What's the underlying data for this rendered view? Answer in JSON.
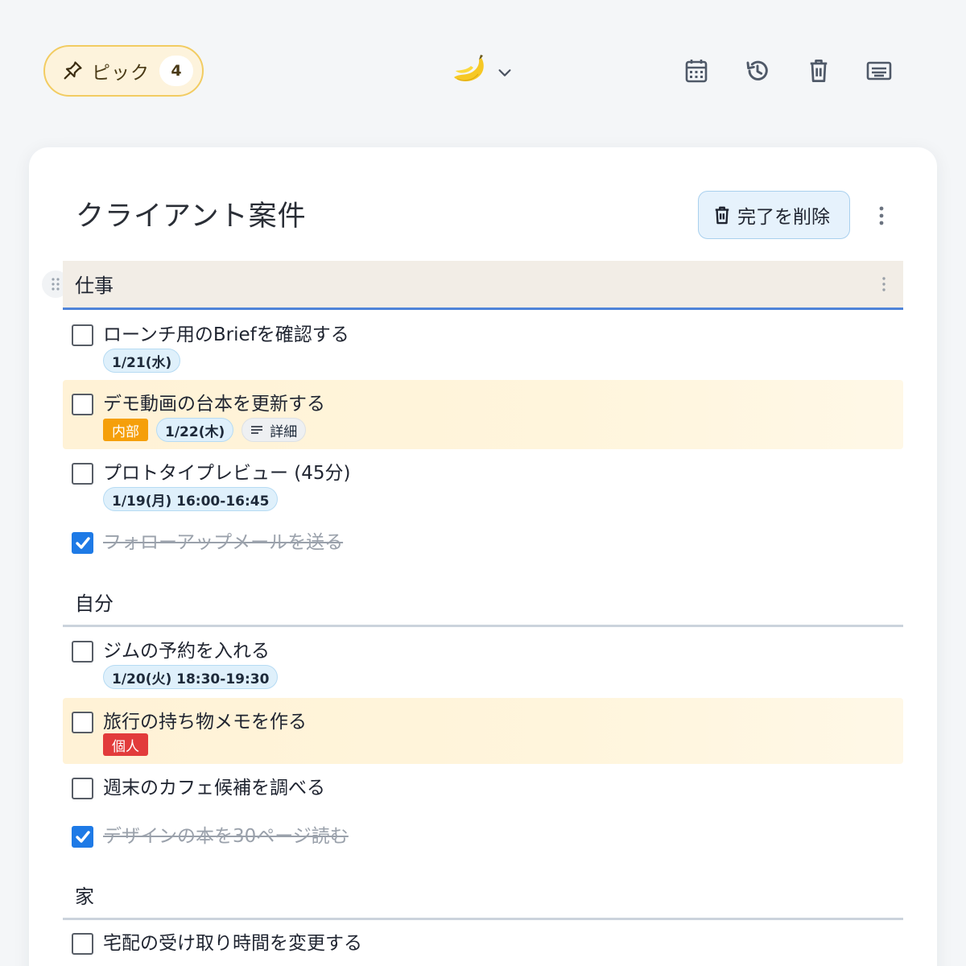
{
  "topbar": {
    "pick_label": "ピック",
    "pick_count": "4",
    "logo_icon": "banana-logo-icon",
    "icons": [
      "calendar-icon",
      "history-icon",
      "trash-icon",
      "keyboard-icon"
    ]
  },
  "list": {
    "title": "クライアント案件",
    "clear_done_label": "完了を削除"
  },
  "sections": [
    {
      "label": "仕事",
      "tasks": [
        {
          "text": "ローンチ用のBriefを確認する",
          "date": "1/21(水)",
          "done": false
        },
        {
          "text": "デモ動画の台本を更新する",
          "tag": "内部",
          "date": "1/22(木)",
          "detail": "詳細",
          "done": false,
          "highlighted": true
        },
        {
          "text": "プロトタイプレビュー (45分)",
          "date": "1/19(月) 16:00-16:45",
          "done": false
        },
        {
          "text": "フォローアップメールを送る",
          "done": true
        }
      ]
    },
    {
      "label": "自分",
      "tasks": [
        {
          "text": "ジムの予約を入れる",
          "date": "1/20(火) 18:30-19:30",
          "done": false
        },
        {
          "text": "旅行の持ち物メモを作る",
          "tag": "個人",
          "done": false,
          "highlighted": true
        },
        {
          "text": "週末のカフェ候補を調べる",
          "done": false
        },
        {
          "text": "デザインの本を30ページ読む",
          "done": true
        }
      ]
    },
    {
      "label": "家",
      "tasks": [
        {
          "text": "宅配の受け取り時間を変更する",
          "done": false
        }
      ]
    }
  ],
  "colors": {
    "accent": "#1e7ae6",
    "pick_bg": "#fdf3dc",
    "highlight_bg": "#fff4da",
    "tag_orange": "#f59f0a",
    "tag_red": "#e23b3b"
  }
}
